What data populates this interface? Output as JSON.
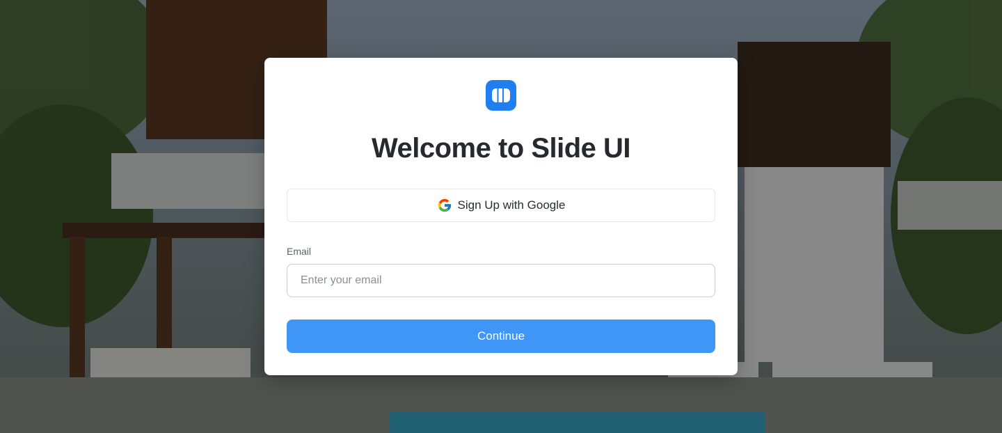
{
  "app": {
    "title": "Welcome to Slide UI",
    "logo_icon": "slide-ui-logo-icon",
    "accent_color": "#1f7ff0"
  },
  "signup": {
    "google_button_label": "Sign Up with Google",
    "google_icon": "google-g-icon"
  },
  "email": {
    "label": "Email",
    "placeholder": "Enter your email",
    "value": ""
  },
  "continue": {
    "label": "Continue",
    "color": "#4096f7"
  }
}
